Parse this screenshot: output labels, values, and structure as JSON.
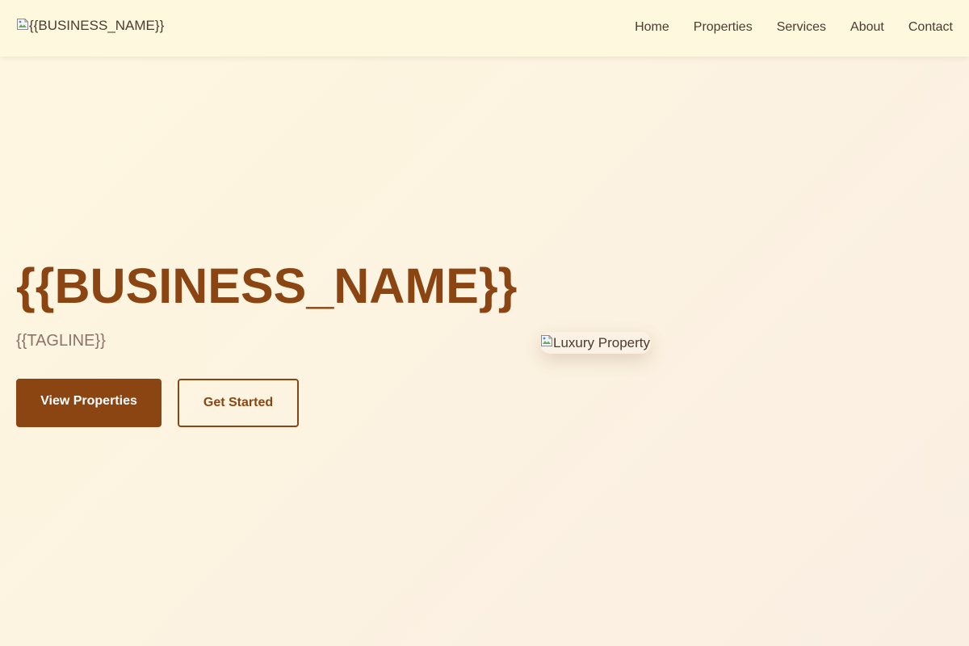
{
  "header": {
    "logo_alt": "{{BUSINESS_NAME}}",
    "nav": [
      {
        "label": "Home"
      },
      {
        "label": "Properties"
      },
      {
        "label": "Services"
      },
      {
        "label": "About"
      },
      {
        "label": "Contact"
      }
    ]
  },
  "hero": {
    "title": "{{BUSINESS_NAME}}",
    "tagline": "{{TAGLINE}}",
    "primary_button": "View Properties",
    "secondary_button": "Get Started",
    "image_alt": "Luxury Property",
    "image_icon": "broken-image-icon"
  },
  "colors": {
    "brand": "#8b4513",
    "text": "#4d3a30",
    "muted": "#8d7268",
    "header_bg": "#fef8df",
    "page_bg": "#fdf5e1"
  }
}
